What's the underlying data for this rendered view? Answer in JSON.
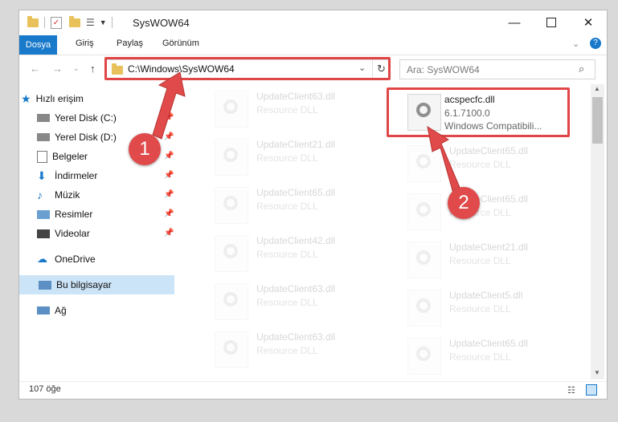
{
  "window": {
    "title": "SysWOW64"
  },
  "ribbon": {
    "tabs": [
      "Dosya",
      "Giriş",
      "Paylaş",
      "Görünüm"
    ]
  },
  "address": {
    "path": "C:\\Windows\\SysWOW64"
  },
  "search": {
    "placeholder": "Ara: SysWOW64"
  },
  "nav": {
    "quick_access": "Hızlı erişim",
    "items": [
      "Yerel Disk (C:)",
      "Yerel Disk (D:)",
      "Belgeler",
      "İndirmeler",
      "Müzik",
      "Resimler",
      "Videolar"
    ],
    "onedrive": "OneDrive",
    "this_pc": "Bu bilgisayar",
    "network": "Ağ"
  },
  "files": {
    "highlight": {
      "name": "acspecfc.dll",
      "version": "6.1.7100.0",
      "desc": "Windows Compatibili..."
    },
    "left": [
      {
        "name": "UpdateClient63.dll",
        "type": "Resource DLL"
      },
      {
        "name": "UpdateClient21.dll",
        "type": "Resource DLL"
      },
      {
        "name": "UpdateClient65.dll",
        "type": "Resource DLL"
      },
      {
        "name": "UpdateClient42.dll",
        "type": "Resource DLL"
      },
      {
        "name": "UpdateClient63.dll",
        "type": "Resource DLL"
      },
      {
        "name": "UpdateClient63.dll",
        "type": "Resource DLL"
      }
    ],
    "right": [
      {
        "name": "UpdateClient65.dll",
        "type": "Resource DLL"
      },
      {
        "name": "UpdateClient65.dll",
        "type": "Resource DLL"
      },
      {
        "name": "UpdateClient21.dll",
        "type": "Resource DLL"
      },
      {
        "name": "UpdateClient5.dll",
        "type": "Resource DLL"
      },
      {
        "name": "UpdateClient65.dll",
        "type": "Resource DLL"
      }
    ]
  },
  "status": {
    "count": "107 öğe"
  },
  "annotations": {
    "step1": "1",
    "step2": "2"
  },
  "colors": {
    "accent": "#1979ca",
    "highlight": "#e04646"
  }
}
